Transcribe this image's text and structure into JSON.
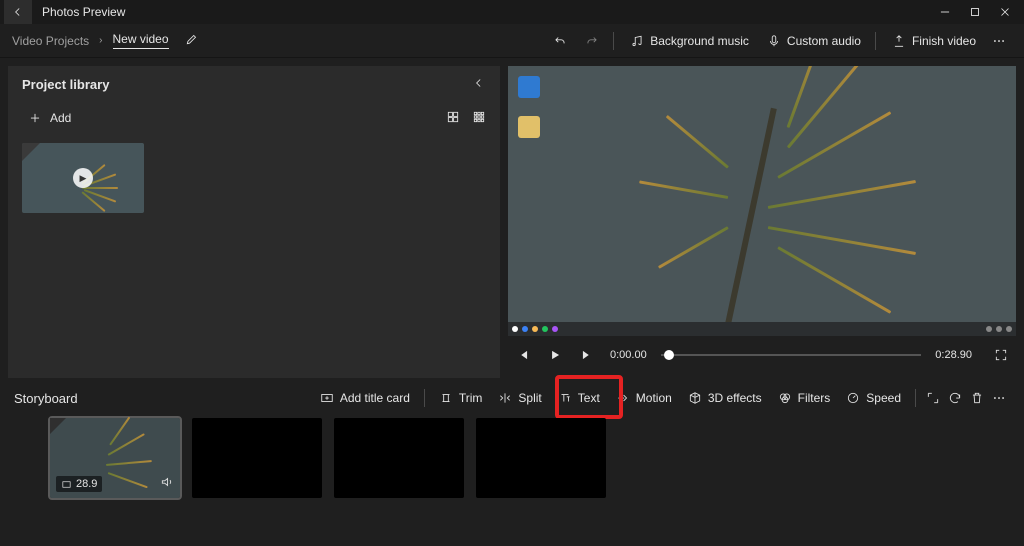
{
  "titlebar": {
    "app_name": "Photos Preview"
  },
  "breadcrumbs": {
    "root": "Video Projects",
    "current": "New video"
  },
  "commands": {
    "bg_music": "Background music",
    "custom_audio": "Custom audio",
    "finish": "Finish video"
  },
  "library": {
    "title": "Project library",
    "add_label": "Add"
  },
  "preview": {
    "current_time": "0:00.00",
    "duration": "0:28.90"
  },
  "storyboard": {
    "title": "Storyboard",
    "buttons": {
      "add_title_card": "Add title card",
      "trim": "Trim",
      "split": "Split",
      "text": "Text",
      "motion": "Motion",
      "effects": "3D effects",
      "filters": "Filters",
      "speed": "Speed"
    },
    "clip_duration": "28.9"
  }
}
